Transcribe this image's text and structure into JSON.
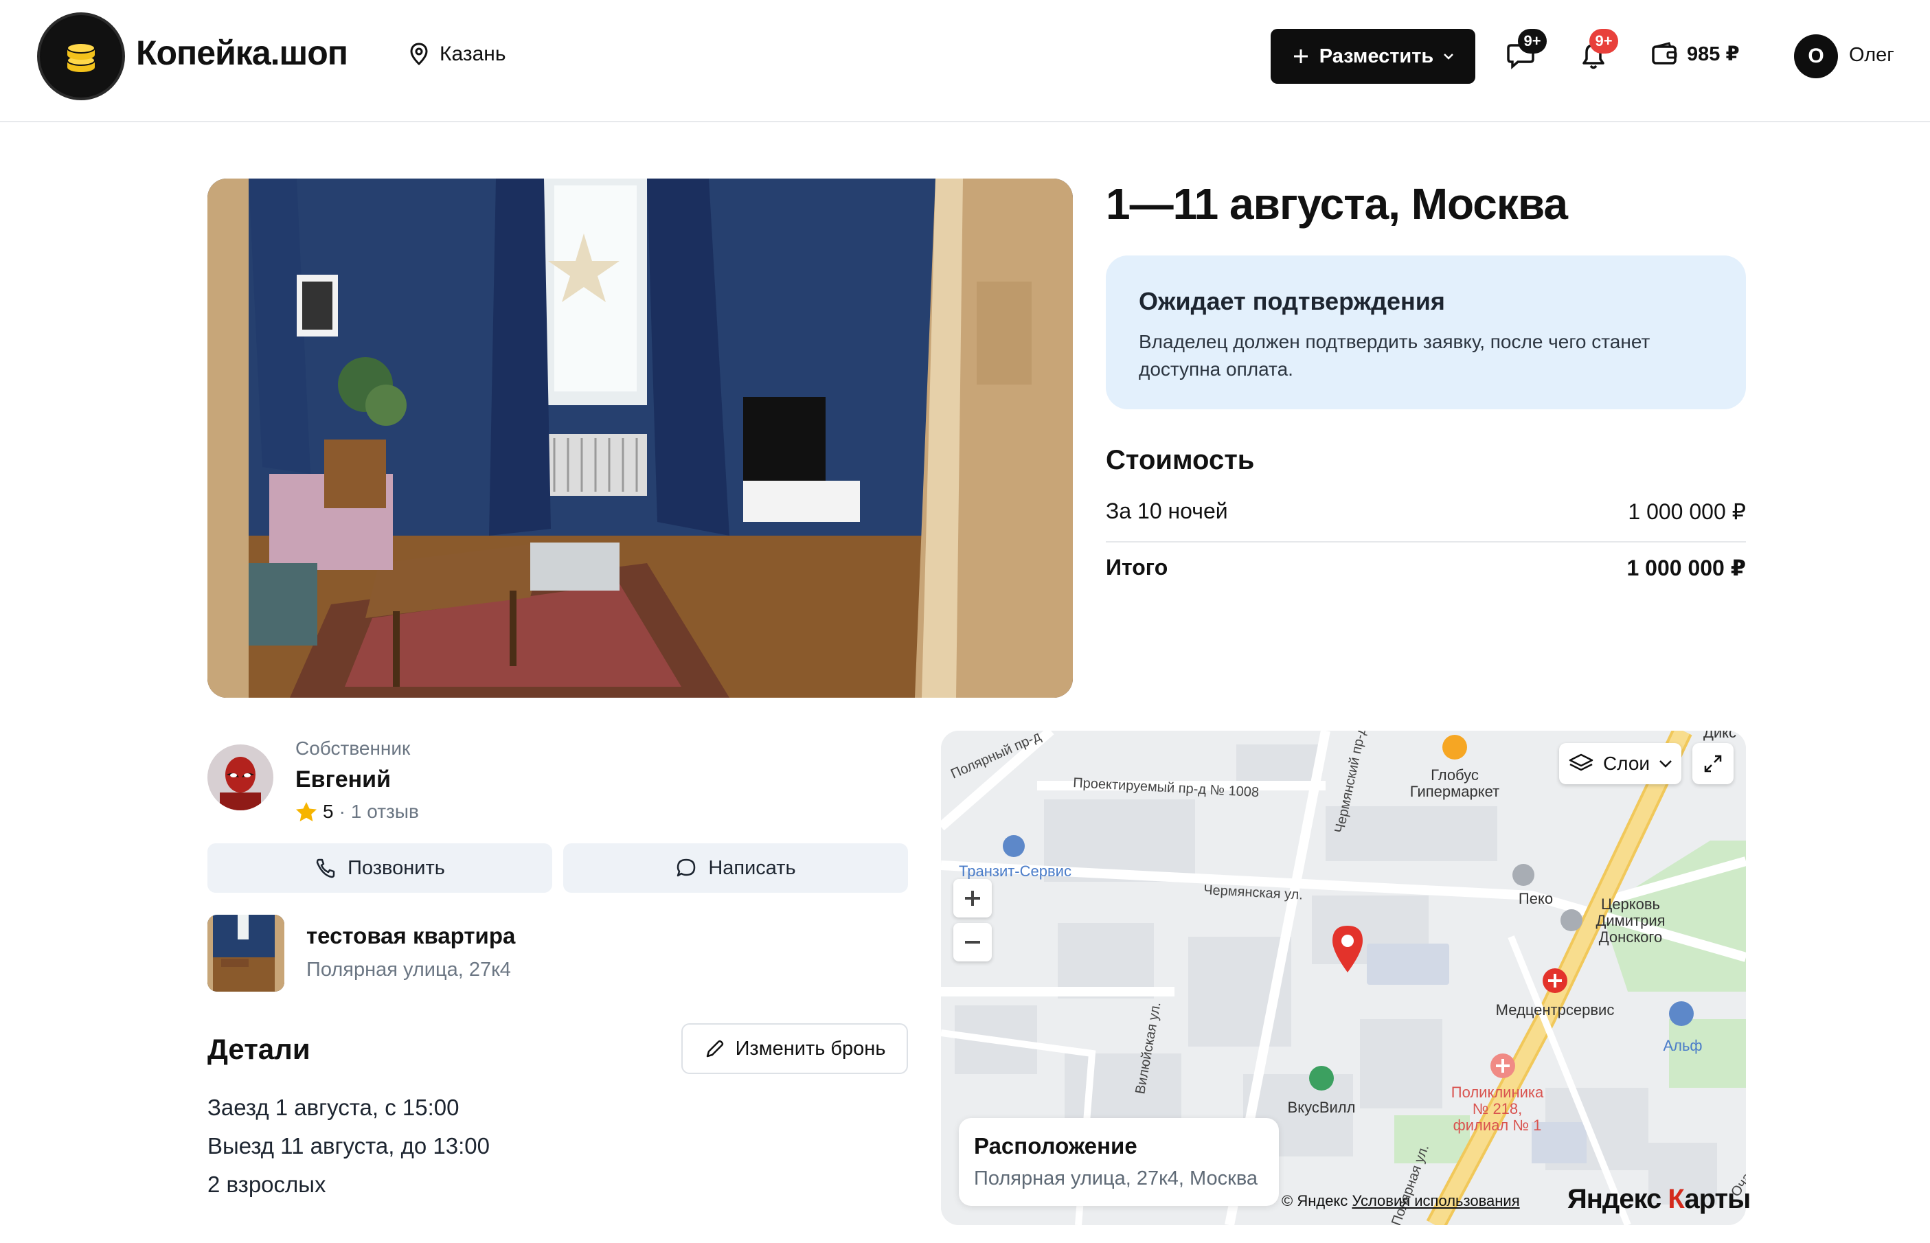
{
  "header": {
    "logo_text": "Копейка.шоп",
    "city": "Казань",
    "post_button": "Разместить",
    "messages_badge": "9+",
    "notifications_badge": "9+",
    "balance": "985 ₽",
    "user_initial": "О",
    "user_name": "Олег"
  },
  "booking": {
    "title": "1—11 августа, Москва",
    "status_title": "Ожидает подтверждения",
    "status_text": "Владелец должен подтвердить заявку, после чего станет доступна оплата."
  },
  "cost": {
    "title": "Стоимость",
    "nights_label": "За 10 ночей",
    "nights_value": "1 000 000 ₽",
    "total_label": "Итого",
    "total_value": "1 000 000 ₽"
  },
  "owner": {
    "role": "Собственник",
    "name": "Евгений",
    "rating": "5",
    "separator": "·",
    "reviews": "1 отзыв",
    "call_label": "Позвонить",
    "message_label": "Написать"
  },
  "flat": {
    "title": "тестовая квартира",
    "address": "Полярная улица, 27к4"
  },
  "details": {
    "title": "Детали",
    "edit_label": "Изменить бронь",
    "checkin": "Заезд 1 августа, с 15:00",
    "checkout": "Выезд 11 августа, до 13:00",
    "guests": "2 взрослых"
  },
  "map": {
    "layers_label": "Слои",
    "card_title": "Расположение",
    "card_address": "Полярная улица, 27к4, Москва",
    "copyright": "© Яндекс",
    "terms": "Условия использования",
    "brand_main": "Яндекс",
    "brand_r": "К",
    "brand_rest": "арты",
    "labels": {
      "globus": "Глобус",
      "globus_sub": "Гипермаркет",
      "proezd": "Проектируемый пр-д № 1008",
      "polyarny": "Полярный пр-д",
      "chermyansky_pr": "Чермянский пр-д",
      "chermyanskaya": "Чермянская ул.",
      "tranzit": "Транзит-Сервис",
      "peko": "Пеко",
      "church1": "Церковь",
      "church2": "Димитрия",
      "church3": "Донского",
      "medcenter": "Медцентрсервис",
      "alf": "Альф",
      "vilyuyskaya": "Вилюйская ул.",
      "vkusvill": "ВкусВилл",
      "poly1": "Поликлиника",
      "poly2": "№ 218,",
      "poly3": "филиал № 1",
      "polyarnaya": "Полярная ул.",
      "dik": "Дикс",
      "ochal": "Очаковская"
    }
  },
  "colors": {
    "accent": "#0e0e0e",
    "status_bg": "#e3f0fc",
    "badge_messages": "#111111",
    "badge_notifications": "#e8403b",
    "button_bg": "#eef2f7",
    "map_pin": "#e3332b",
    "star": "#f6b400"
  },
  "icons": {
    "logo": "coin-stack-icon",
    "city": "location-pin-icon",
    "post": "plus-icon",
    "post_caret": "chevron-down-icon",
    "messages": "chat-icon",
    "notifications": "bell-icon",
    "wallet": "wallet-icon",
    "call": "phone-icon",
    "message": "chat-bubble-icon",
    "edit": "pencil-icon",
    "layers": "layers-icon",
    "expand": "expand-icon",
    "star": "star-icon"
  }
}
